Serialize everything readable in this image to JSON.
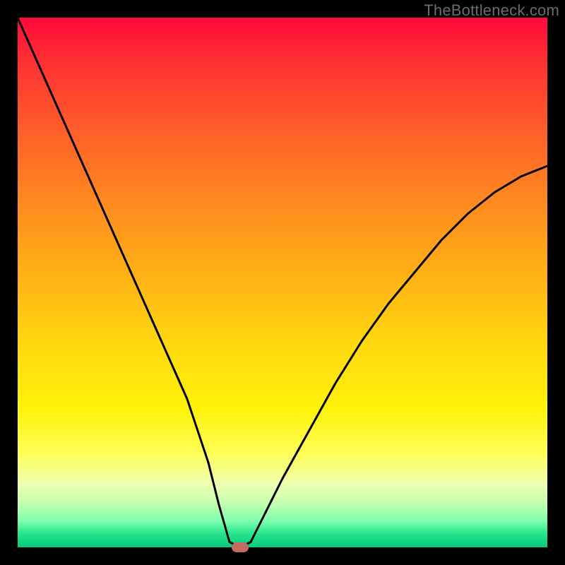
{
  "watermark": "TheBottleneck.com",
  "colors": {
    "marker_fill": "#c46a5f",
    "curve_stroke": "#000000"
  },
  "chart_data": {
    "type": "line",
    "title": "",
    "xlabel": "",
    "ylabel": "",
    "xlim": [
      0,
      100
    ],
    "ylim": [
      0,
      100
    ],
    "grid": false,
    "legend": null,
    "annotations": [],
    "series": [
      {
        "name": "bottleneck-curve",
        "x": [
          0,
          4,
          8,
          12,
          16,
          20,
          24,
          28,
          32,
          36,
          38,
          40,
          42,
          44,
          46,
          50,
          55,
          60,
          65,
          70,
          75,
          80,
          85,
          90,
          95,
          100
        ],
        "values": [
          100,
          91,
          82,
          73,
          64,
          55,
          46,
          37,
          28,
          16,
          8,
          1,
          0,
          1,
          5,
          13,
          22,
          31,
          39,
          46,
          52,
          58,
          63,
          67,
          70,
          72
        ]
      }
    ],
    "marker": {
      "x": 42,
      "y": 0
    }
  }
}
